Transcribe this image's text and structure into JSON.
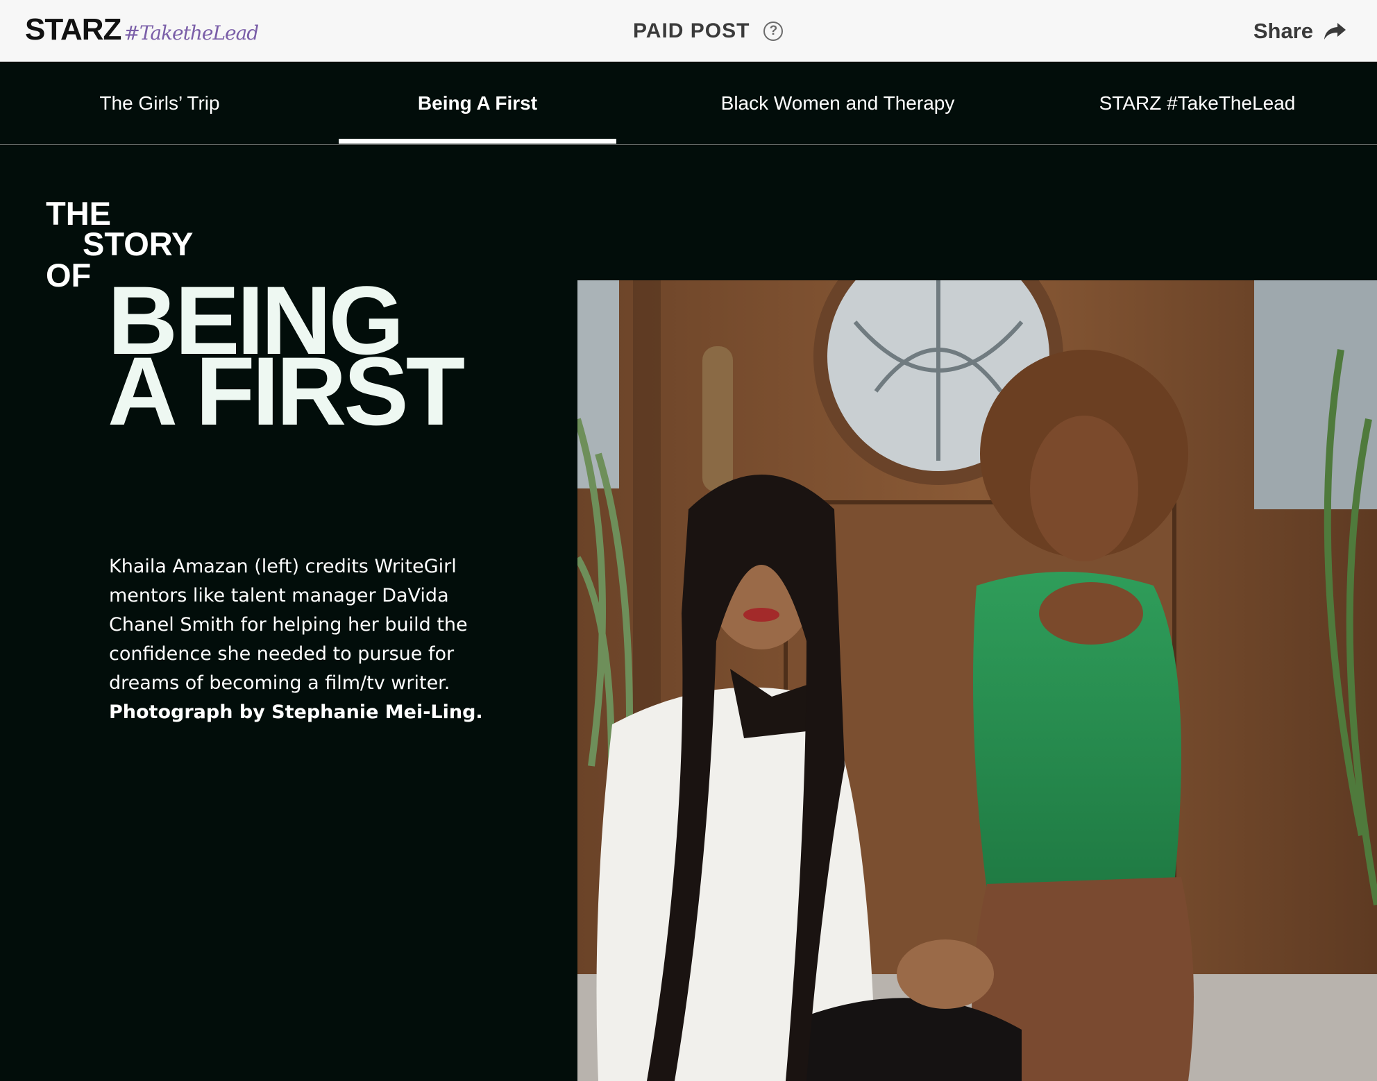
{
  "header": {
    "logo_brand": "STARZ",
    "logo_tag": "#TaketheLead",
    "paid_label": "PAID POST",
    "help_symbol": "?",
    "share_label": "Share"
  },
  "nav": {
    "tabs": [
      {
        "label": "The Girls’ Trip",
        "active": false
      },
      {
        "label": "Being A First",
        "active": true
      },
      {
        "label": "Black Women and Therapy",
        "active": false
      },
      {
        "label": "STARZ #TakeTheLead",
        "active": false
      }
    ]
  },
  "headline": {
    "line_the": "THE",
    "line_story": "STORY",
    "line_of": "OF",
    "line_being": "BEING",
    "line_a_first": "A FIRST"
  },
  "caption": {
    "text": "Khaila Amazan (left) credits WriteGirl mentors like talent manager DaVida Chanel Smith for helping her build the confidence she needed to pursue for dreams of becoming a film/tv writer. ",
    "credit": "Photograph by Stephanie Mei-Ling."
  },
  "icons": {
    "help": "question-circle-icon",
    "share": "share-arrow-icon"
  },
  "colors": {
    "page_background": "#020d0a",
    "header_background": "#f7f7f7",
    "logo_tag": "#7a5ea8",
    "headline": "#eef8f2"
  }
}
